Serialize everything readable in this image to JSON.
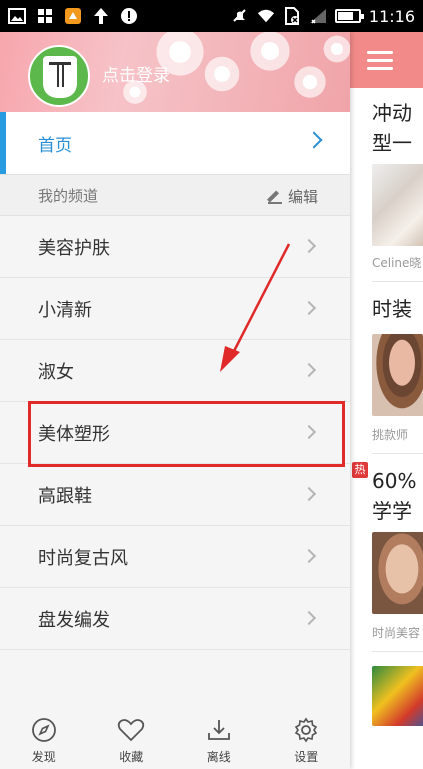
{
  "status_bar": {
    "time": "11:16",
    "battery_level": 0.75,
    "icons": [
      "photo-icon",
      "grid-icon",
      "game-icon",
      "upload-arrow-icon",
      "alert-icon",
      "mute-icon",
      "wifi-icon",
      "no-sim-icon",
      "signal-icon",
      "battery-icon"
    ]
  },
  "drawer": {
    "login_text": "点击登录",
    "home_label": "首页",
    "section_label": "我的频道",
    "edit_label": "编辑",
    "channels": [
      {
        "label": "美容护肤"
      },
      {
        "label": "小清新"
      },
      {
        "label": "淑女"
      },
      {
        "label": "美体塑形"
      },
      {
        "label": "高跟鞋"
      },
      {
        "label": "时尚复古风"
      },
      {
        "label": "盘发编发"
      }
    ],
    "highlighted_channel": "美体塑形"
  },
  "bottom_nav": {
    "items": [
      {
        "label": "发现",
        "icon": "compass-icon"
      },
      {
        "label": "收藏",
        "icon": "heart-icon"
      },
      {
        "label": "离线",
        "icon": "download-icon"
      },
      {
        "label": "设置",
        "icon": "gear-icon"
      }
    ]
  },
  "content": {
    "cards": [
      {
        "title_line1": "冲动",
        "title_line2": "型一",
        "source": "Celine晓"
      },
      {
        "title_line1": "时装",
        "source": "挑款师"
      },
      {
        "title_line1": "60%",
        "title_line2": "学学",
        "source": "时尚美容",
        "hot_badge": "热"
      }
    ]
  },
  "colors": {
    "accent_blue": "#2a9be0",
    "highlight_red": "#e02a2a",
    "content_header": "#f28a8a",
    "avatar_green": "#5cb84a"
  }
}
